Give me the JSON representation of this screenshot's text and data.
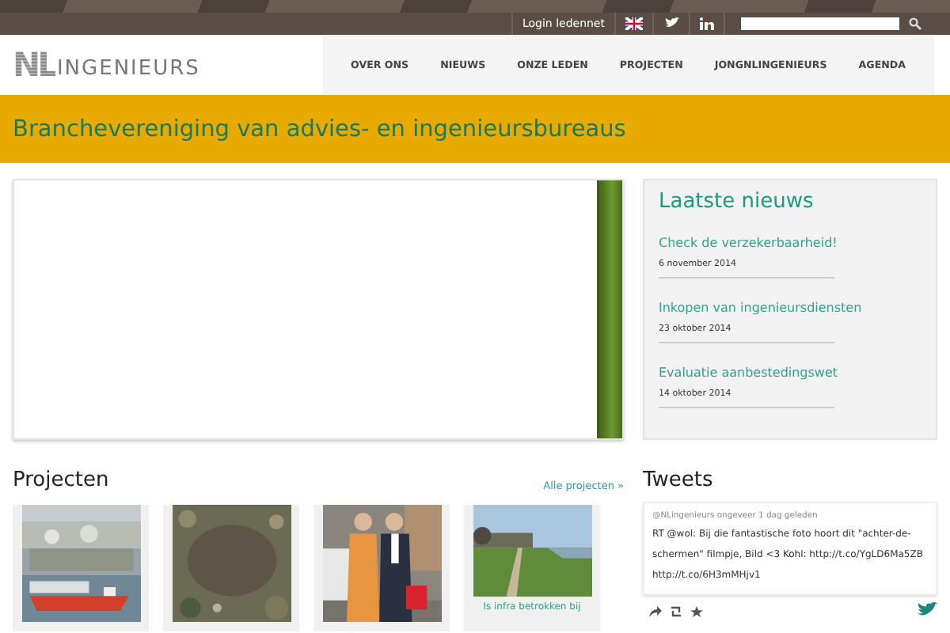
{
  "topbar": {
    "login": "Login ledennet"
  },
  "header": {
    "logo_mark": "NL",
    "logo_text": "INGENIEURS",
    "nav": [
      {
        "label": "OVER ONS",
        "selected": false
      },
      {
        "label": "NIEUWS",
        "selected": false
      },
      {
        "label": "ONZE LEDEN",
        "selected": false
      },
      {
        "label": "PROJECTEN",
        "selected": false
      },
      {
        "label": "JONGNLINGENIEURS",
        "selected": false
      },
      {
        "label": "AGENDA",
        "selected": false
      }
    ]
  },
  "banner": {
    "title": "Branchevereniging van advies- en ingenieursbureaus"
  },
  "news": {
    "title": "Laatste nieuws",
    "items": [
      {
        "title": "Check de verzekerbaarheid!",
        "date": "6 november 2014"
      },
      {
        "title": "Inkopen van ingenieursdiensten",
        "date": "23 oktober 2014"
      },
      {
        "title": "Evaluatie aanbestedingswet",
        "date": "14 oktober 2014"
      }
    ]
  },
  "projects": {
    "title": "Projecten",
    "link": "Alle projecten »",
    "items": [
      {
        "kind": "picture"
      },
      {
        "kind": "picture"
      },
      {
        "kind": "picture"
      },
      {
        "kind": "picture",
        "caption": "Is infra betrokken bij"
      }
    ]
  },
  "tweets": {
    "title": "Tweets",
    "items": [
      {
        "meta": "@NLingenieurs ongeveer 1 dag geleden",
        "text": "RT @wol: Bij die fantastische foto hoort dit \"achter-de-schermen\" filmpje, Bild <3 Kohl: http://t.co/YgLD6Ma5ZB http://t.co/6H3mMHjv1"
      }
    ]
  }
}
